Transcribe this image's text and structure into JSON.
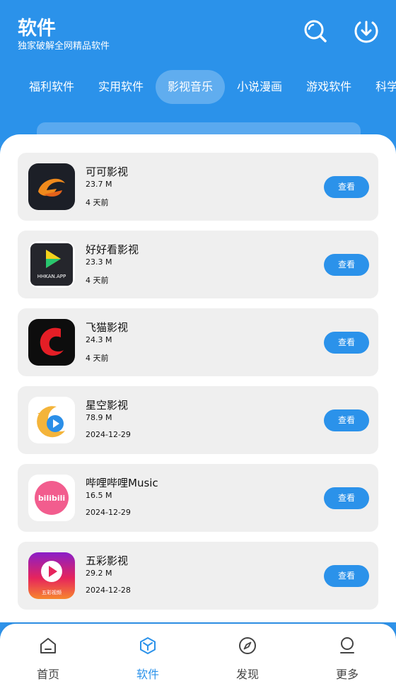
{
  "header": {
    "title": "软件",
    "subtitle": "独家破解全网精品软件",
    "search_icon": "search-icon",
    "download_icon": "download-icon"
  },
  "tabs": [
    {
      "label": "福利软件",
      "active": false
    },
    {
      "label": "实用软件",
      "active": false
    },
    {
      "label": "影视音乐",
      "active": true
    },
    {
      "label": "小说漫画",
      "active": false
    },
    {
      "label": "游戏软件",
      "active": false
    },
    {
      "label": "科学上",
      "active": false
    }
  ],
  "apps": [
    {
      "name": "可可影视",
      "size": "23.7 M",
      "date": "4 天前",
      "button": "查看",
      "icon": "keke-icon"
    },
    {
      "name": "好好看影视",
      "size": "23.3 M",
      "date": "4 天前",
      "button": "查看",
      "icon": "hhkan-icon",
      "icon_text": "HHKAN.APP"
    },
    {
      "name": "飞猫影视",
      "size": "24.3 M",
      "date": "4 天前",
      "button": "查看",
      "icon": "feimao-icon"
    },
    {
      "name": "星空影视",
      "size": "78.9 M",
      "date": "2024-12-29",
      "button": "查看",
      "icon": "xingkong-icon"
    },
    {
      "name": "哔哩哔哩Music",
      "size": "16.5 M",
      "date": "2024-12-29",
      "button": "查看",
      "icon": "bilibili-icon",
      "icon_text": "bilibili"
    },
    {
      "name": "五彩影视",
      "size": "29.2 M",
      "date": "2024-12-28",
      "button": "查看",
      "icon": "wucai-icon",
      "icon_text": "五彩视频"
    }
  ],
  "nav": [
    {
      "label": "首页",
      "icon": "home-icon",
      "active": false
    },
    {
      "label": "软件",
      "icon": "box-icon",
      "active": true
    },
    {
      "label": "发现",
      "icon": "compass-icon",
      "active": false
    },
    {
      "label": "更多",
      "icon": "user-icon",
      "active": false
    }
  ],
  "colors": {
    "accent": "#2b92ea",
    "card": "#efefef"
  }
}
